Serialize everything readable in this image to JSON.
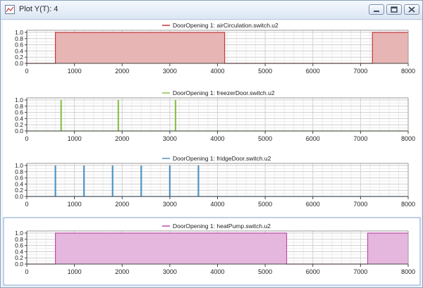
{
  "window": {
    "title": "Plot Y(T): 4",
    "icons": {
      "app": "plot-icon",
      "minimize": "minimize-icon",
      "restore": "restore-icon",
      "close": "close-icon"
    }
  },
  "chart_data": [
    {
      "type": "line",
      "fill": "area",
      "color": "#c0393b",
      "fill_color": "#e8b5b5",
      "series": [
        {
          "name": "DoorOpening 1: airCirculation.switch.u2",
          "x": [
            0,
            600,
            600,
            4150,
            4150,
            7250,
            7250,
            8000
          ],
          "y": [
            0,
            0,
            1,
            1,
            0,
            0,
            1,
            1
          ]
        }
      ],
      "x_ticks": [
        "0",
        "1000",
        "2000",
        "3000",
        "4000",
        "5000",
        "6000",
        "7000",
        "8000"
      ],
      "y_ticks": [
        "0.0",
        "0.2",
        "0.4",
        "0.6",
        "0.8",
        "1.0"
      ],
      "xlim": [
        0,
        8000
      ],
      "ylim": [
        0,
        1
      ],
      "grid": true,
      "legend": "top-center"
    },
    {
      "type": "line",
      "fill": "spikes",
      "color": "#8dc04f",
      "series": [
        {
          "name": "DoorOpening 1: freezerDoor.switch.u2",
          "x": [
            720,
            1920,
            3120
          ],
          "y": [
            1,
            1,
            1
          ]
        }
      ],
      "x_ticks": [
        "0",
        "1000",
        "2000",
        "3000",
        "4000",
        "5000",
        "6000",
        "7000",
        "8000"
      ],
      "y_ticks": [
        "0.0",
        "0.2",
        "0.4",
        "0.6",
        "0.8",
        "1.0"
      ],
      "xlim": [
        0,
        8000
      ],
      "ylim": [
        0,
        1
      ],
      "grid": true,
      "legend": "top-center"
    },
    {
      "type": "line",
      "fill": "spikes",
      "color": "#4f94c6",
      "series": [
        {
          "name": "DoorOpening 1: fridgeDoor.switch.u2",
          "x": [
            600,
            1200,
            1800,
            2400,
            3000,
            3600
          ],
          "y": [
            1,
            1,
            1,
            1,
            1,
            1
          ]
        }
      ],
      "x_ticks": [
        "0",
        "1000",
        "2000",
        "3000",
        "4000",
        "5000",
        "6000",
        "7000",
        "8000"
      ],
      "y_ticks": [
        "0.0",
        "0.2",
        "0.4",
        "0.6",
        "0.8",
        "1.0"
      ],
      "xlim": [
        0,
        8000
      ],
      "ylim": [
        0,
        1
      ],
      "grid": true,
      "legend": "top-center"
    },
    {
      "type": "line",
      "fill": "area",
      "color": "#bc4fa8",
      "fill_color": "#e6b7de",
      "series": [
        {
          "name": "DoorOpening 1: heatPump.switch.u2",
          "x": [
            0,
            600,
            600,
            5450,
            5450,
            7150,
            7150,
            8000
          ],
          "y": [
            0,
            0,
            1,
            1,
            0,
            0,
            1,
            1
          ]
        }
      ],
      "x_ticks": [
        "0",
        "1000",
        "2000",
        "3000",
        "4000",
        "5000",
        "6000",
        "7000",
        "8000"
      ],
      "y_ticks": [
        "0.0",
        "0.2",
        "0.4",
        "0.6",
        "0.8",
        "1.0"
      ],
      "xlim": [
        0,
        8000
      ],
      "ylim": [
        0,
        1
      ],
      "grid": true,
      "legend": "top-center"
    }
  ]
}
